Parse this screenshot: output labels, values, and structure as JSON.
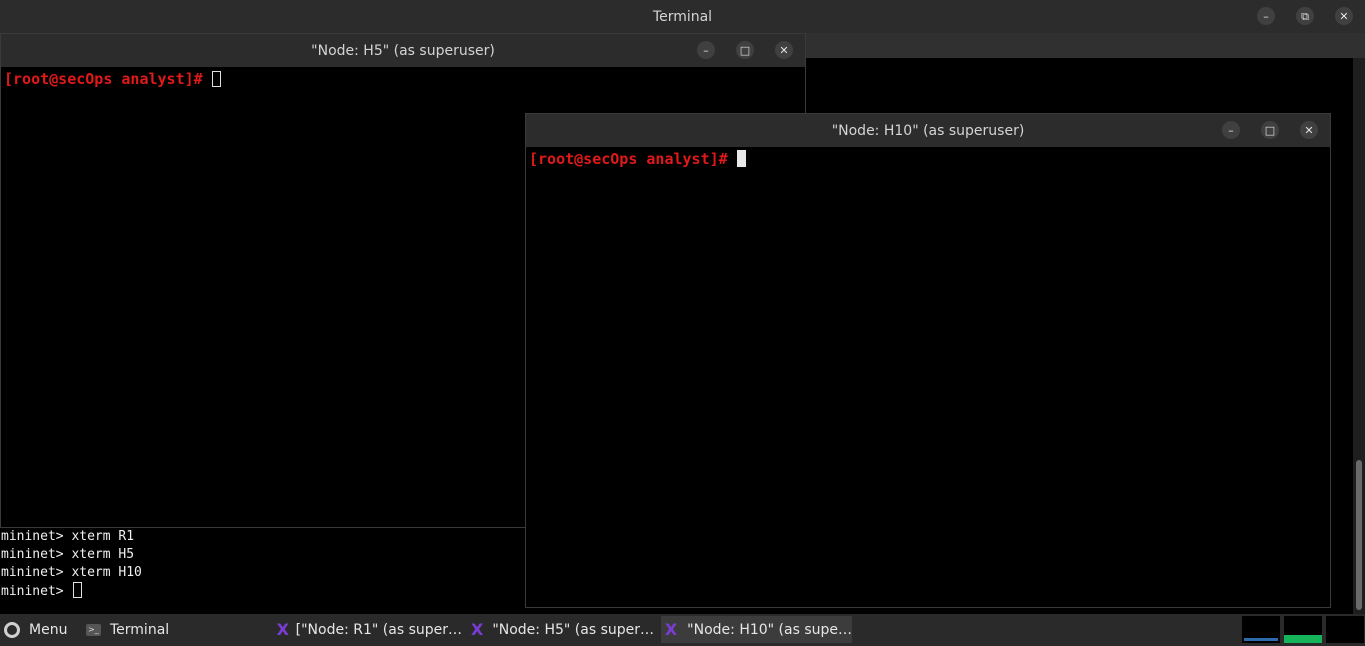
{
  "main_window": {
    "title": "Terminal",
    "controls": {
      "minimize": "–",
      "maximize": "⧉",
      "close": "✕"
    }
  },
  "h5_window": {
    "title": "\"Node: H5\" (as superuser)",
    "prompt": "[root@secOps analyst]# ",
    "controls": {
      "minimize": "–",
      "maximize": "□",
      "close": "✕"
    }
  },
  "h10_window": {
    "title": "\"Node: H10\" (as superuser)",
    "prompt": "[root@secOps analyst]# ",
    "controls": {
      "minimize": "–",
      "maximize": "□",
      "close": "✕"
    }
  },
  "mininet": {
    "lines": [
      "mininet> xterm R1",
      "mininet> xterm H5",
      "mininet> xterm H10"
    ],
    "current_prompt": "mininet> "
  },
  "taskbar": {
    "menu_label": "Menu",
    "terminal_label": "Terminal",
    "tasks": [
      {
        "label": "[\"Node: R1\" (as super…",
        "icon": "x-icon"
      },
      {
        "label": "\"Node: H5\" (as super…",
        "icon": "x-icon"
      },
      {
        "label": "\"Node: H10\" (as supe…",
        "icon": "x-icon"
      }
    ]
  },
  "colors": {
    "prompt_red": "#e11919",
    "xterm_icon": "#7b3cd6",
    "graph_green": "#16b45a",
    "graph_blue": "#3a86d6"
  }
}
